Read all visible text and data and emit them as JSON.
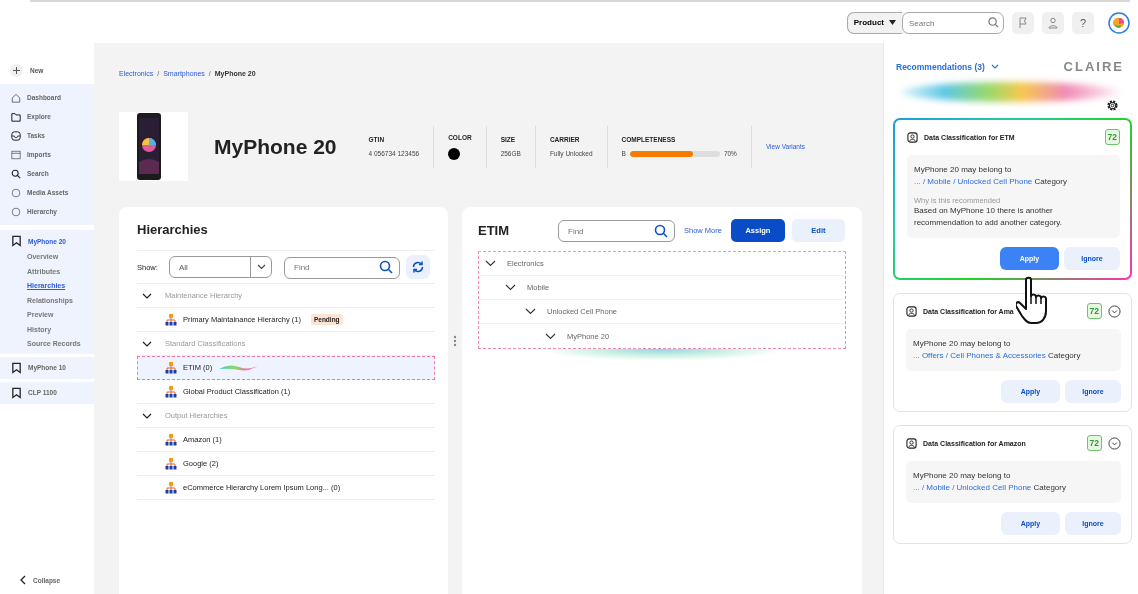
{
  "topbar": {
    "scope": "Product",
    "search": {
      "placeholder": "Search"
    },
    "help": "?"
  },
  "sidebar": {
    "new": "New",
    "nav": [
      {
        "label": "Dashboard"
      },
      {
        "label": "Explore"
      },
      {
        "label": "Tasks"
      },
      {
        "label": "Imports"
      },
      {
        "label": "Search"
      },
      {
        "label": "Media Assets"
      },
      {
        "label": "Hierarchy"
      }
    ],
    "products": [
      {
        "label": "MyPhone 20",
        "selected": true,
        "children": [
          {
            "label": "Overview",
            "selected": false
          },
          {
            "label": "Attributes",
            "selected": false
          },
          {
            "label": "Hierarchies",
            "selected": true
          },
          {
            "label": "Relationships",
            "selected": false
          },
          {
            "label": "Preview",
            "selected": false
          },
          {
            "label": "History",
            "selected": false
          },
          {
            "label": "Source Records",
            "selected": false
          }
        ]
      },
      {
        "label": "MyPhone 10",
        "selected": false
      },
      {
        "label": "CLP 1100",
        "selected": false
      }
    ],
    "collapse": "Collapse"
  },
  "breadcrumb": [
    {
      "label": "Electronics",
      "link": true
    },
    {
      "separator": "/",
      "label": "Smartphones",
      "link": true
    },
    {
      "separator": "/",
      "label": "MyPhone 20",
      "link": false
    }
  ],
  "product": {
    "title": "MyPhone 20",
    "attributes": [
      {
        "kind": "text",
        "label": "GTIN",
        "value": "4 056734 123456"
      },
      {
        "kind": "color",
        "label": "COLOR",
        "color": "#000000"
      },
      {
        "kind": "text",
        "label": "SIZE",
        "value": "256GB"
      },
      {
        "kind": "text",
        "label": "CARRIER",
        "value": "Fully Unlocked"
      },
      {
        "kind": "meter",
        "label": "COMPLETENESS",
        "grade": "B",
        "level": 0.7,
        "reading": "70%"
      }
    ],
    "link": "View Variants"
  },
  "hierarchies": {
    "title": "Hierarchies",
    "show_label": "Show:",
    "show_value": "All",
    "find": {
      "placeholder": "Find"
    },
    "groups": [
      {
        "label": "Maintenance Hierarchy",
        "expanded": true,
        "items": [
          {
            "label": "Primary Maintainance Hierarchy (1)",
            "badge": "Pending",
            "selected": false
          }
        ]
      },
      {
        "label": "Standard Classifications",
        "expanded": true,
        "items": [
          {
            "label": "ETIM (0)",
            "selected": true
          },
          {
            "label": "Global Product Classification (1)",
            "selected": false
          }
        ]
      },
      {
        "label": "Output Hierarchies",
        "expanded": true,
        "items": [
          {
            "label": "Amazon (1)",
            "selected": false
          },
          {
            "label": "Google (2)",
            "selected": false
          },
          {
            "label": "eCommerce Hierarchy Lorem Ipsum Long... (0)",
            "selected": false
          }
        ]
      }
    ]
  },
  "etim": {
    "title": "ETIM",
    "find": {
      "placeholder": "Find"
    },
    "show_more": "Show More",
    "assign": "Assign",
    "edit": "Edit",
    "tree": [
      {
        "label": "Electronics",
        "expanded": true,
        "children": [
          {
            "label": "Mobile",
            "expanded": true,
            "children": [
              {
                "label": "Unlocked Cell Phone",
                "expanded": true,
                "children": [
                  {
                    "label": "MyPhone 20",
                    "expanded": true
                  }
                ]
              }
            ]
          }
        ]
      }
    ]
  },
  "recommendations": {
    "title": "Recommendations (3)",
    "logo": "CLAIRE",
    "cards": [
      {
        "title": "Data Classification for ETM",
        "score": "72",
        "highlighted": true,
        "lead": "MyPhone 20 may belong to",
        "path": "... / Mobile / Unlocked Cell Phone",
        "suffix": "Category",
        "why_label": "Why is this recommended",
        "why": "Based on MyPhone 10 there is another recommendation to add another category.",
        "apply": "Apply",
        "ignore": "Ignore"
      },
      {
        "title": "Data Classification for Ama",
        "score": "72",
        "highlighted": false,
        "lead": "MyPhone 20 may belong to",
        "path": "... Offers / Cell Phones & Accessories",
        "suffix": "Category",
        "apply": "Apply",
        "ignore": "Ignore"
      },
      {
        "title": "Data Classification for Amazon",
        "score": "72",
        "highlighted": false,
        "lead": "MyPhone 20 may belong to",
        "path": "... / Mobile / Unlocked Cell Phone",
        "suffix": "Category",
        "apply": "Apply",
        "ignore": "Ignore"
      }
    ]
  }
}
